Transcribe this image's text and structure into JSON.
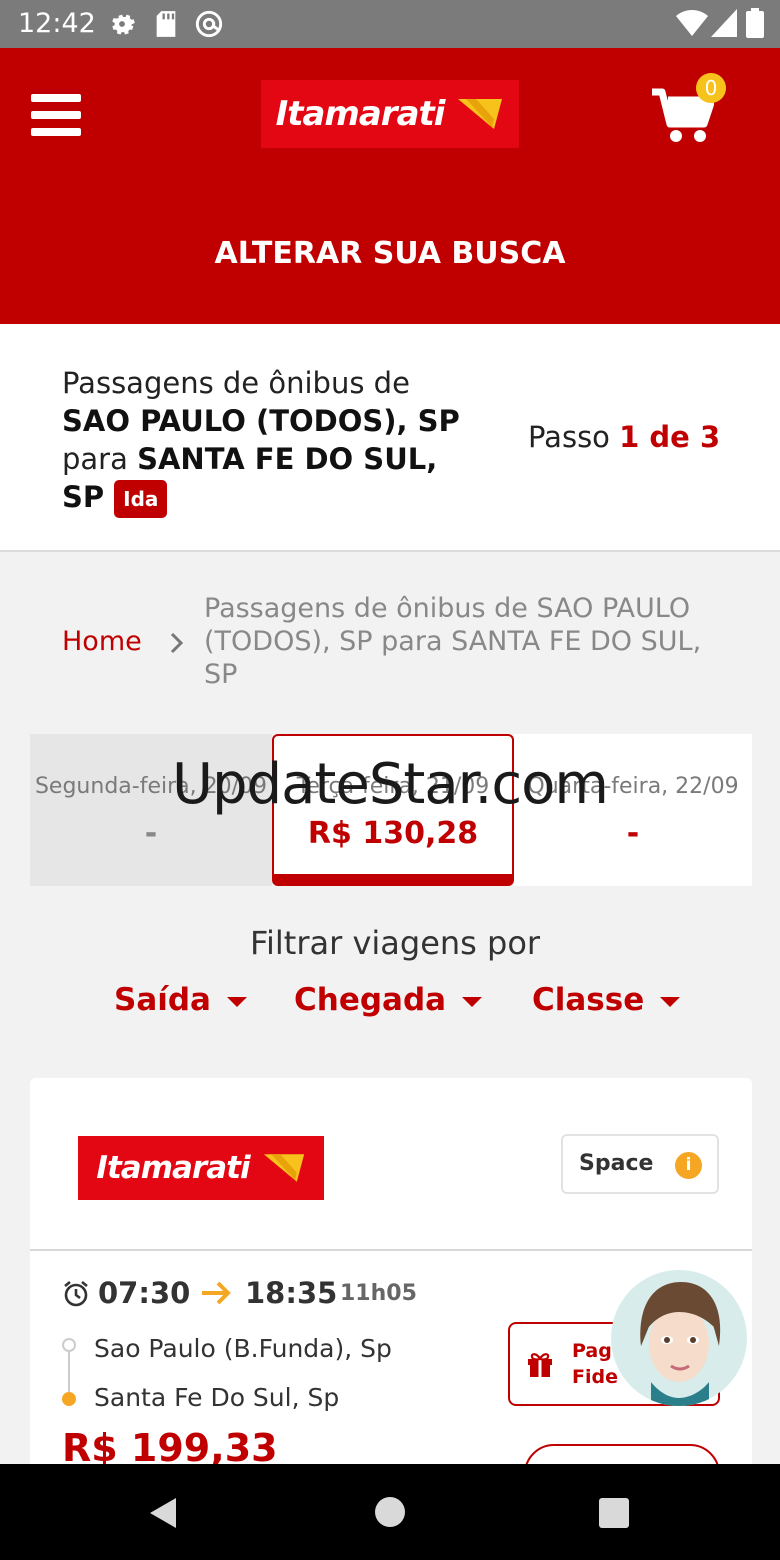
{
  "status_bar": {
    "time": "12:42"
  },
  "header": {
    "brand": "Itamarati",
    "cart_count": "0",
    "alterar_label": "ALTERAR SUA BUSCA"
  },
  "route": {
    "prefix": "Passagens de ônibus de",
    "origin": "SAO PAULO (TODOS), SP",
    "connector": "para",
    "destination_line1": "SANTA FE DO SUL,",
    "destination_line2": "SP",
    "trip_badge": "Ida",
    "step_label": "Passo",
    "step_value": "1 de 3"
  },
  "breadcrumb": {
    "home": "Home",
    "current": "Passagens de ônibus de SAO PAULO (TODOS), SP para SANTA FE DO SUL, SP"
  },
  "dates": [
    {
      "label": "Segunda-feira, 20/09",
      "price": "-"
    },
    {
      "label": "Terça-feira, 21/09",
      "price": "R$ 130,28"
    },
    {
      "label": "Quarta-feira, 22/09",
      "price": "-"
    }
  ],
  "watermark": "UpdateStar.com",
  "filters": {
    "title": "Filtrar viagens por",
    "items": [
      "Saída",
      "Chegada",
      "Classe"
    ]
  },
  "trip": {
    "brand": "Itamarati",
    "class_label": "Space",
    "info_glyph": "i",
    "departure": "07:30",
    "arrival": "18:35",
    "duration": "11h05",
    "origin_stop": "Sao Paulo (B.Funda), Sp",
    "destination_stop": "Santa Fe Do Sul, Sp",
    "price": "R$ 199,33",
    "fidelidade_label": "Pag Fide"
  },
  "icons": {
    "settings": "gear-icon",
    "sd_card": "sd-card-icon",
    "at_sign": "at-icon",
    "wifi": "wifi-icon",
    "signal": "signal-icon",
    "battery": "battery-icon",
    "menu": "hamburger-icon",
    "cart": "cart-icon",
    "chevron": "chevron-right-icon",
    "alarm": "alarm-clock-icon",
    "arrow": "arrow-right-icon",
    "gift": "gift-icon",
    "back": "back-icon",
    "home": "home-icon",
    "recents": "recents-icon"
  },
  "colors": {
    "brand_red": "#c00000",
    "accent_yellow": "#f5a623",
    "status_bar": "#7b7b7b"
  }
}
